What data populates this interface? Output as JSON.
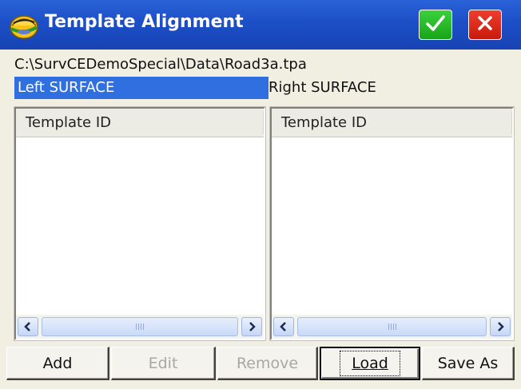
{
  "window": {
    "title": "Template Alignment",
    "icon": "hardhat-app-icon",
    "ok_icon": "checkmark-icon",
    "close_icon": "close-icon"
  },
  "file_path": "C:\\SurvCEDemoSpecial\\Data\\Road3a.tpa",
  "tabs": {
    "left": "Left SURFACE",
    "right": "Right SURFACE",
    "selected": "left"
  },
  "lists": {
    "left": {
      "column_header": "Template ID",
      "rows": []
    },
    "right": {
      "column_header": "Template ID",
      "rows": []
    }
  },
  "buttons": {
    "add": "Add",
    "edit": "Edit",
    "remove": "Remove",
    "load": "Load",
    "save_as": "Save As"
  },
  "colors": {
    "titlebar": "#1c4fc7",
    "selection": "#2f6fe0",
    "ok": "#18a418",
    "close": "#c81a0c"
  }
}
